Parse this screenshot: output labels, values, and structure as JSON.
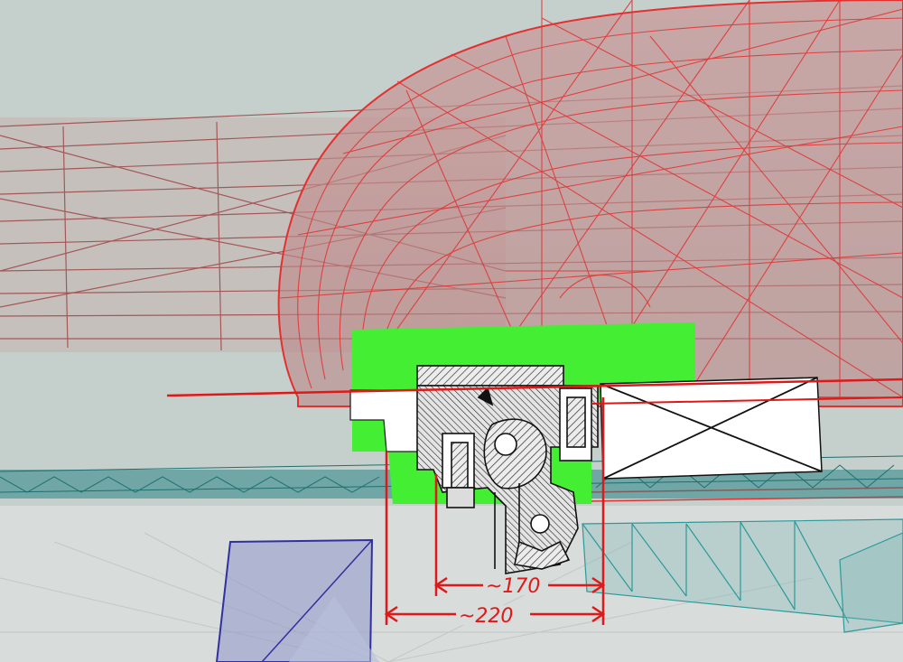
{
  "viewport": {
    "background": "#c8d2cf",
    "floor_color": "#d9dedd",
    "wireframe_red": "#e33030",
    "wireframe_dark_red": "#9c3a3a",
    "wireframe_teal": "#1f8a8a",
    "wireframe_blue": "#3030a0",
    "highlight_green": "#44ee33",
    "dimension_red": "#e01818"
  },
  "dimensions": {
    "inner_label": "~170",
    "outer_label": "~220"
  },
  "components": {
    "cross_section_insert": "mechanical-cross-section",
    "placeholder_box": "crossed-rectangle"
  }
}
